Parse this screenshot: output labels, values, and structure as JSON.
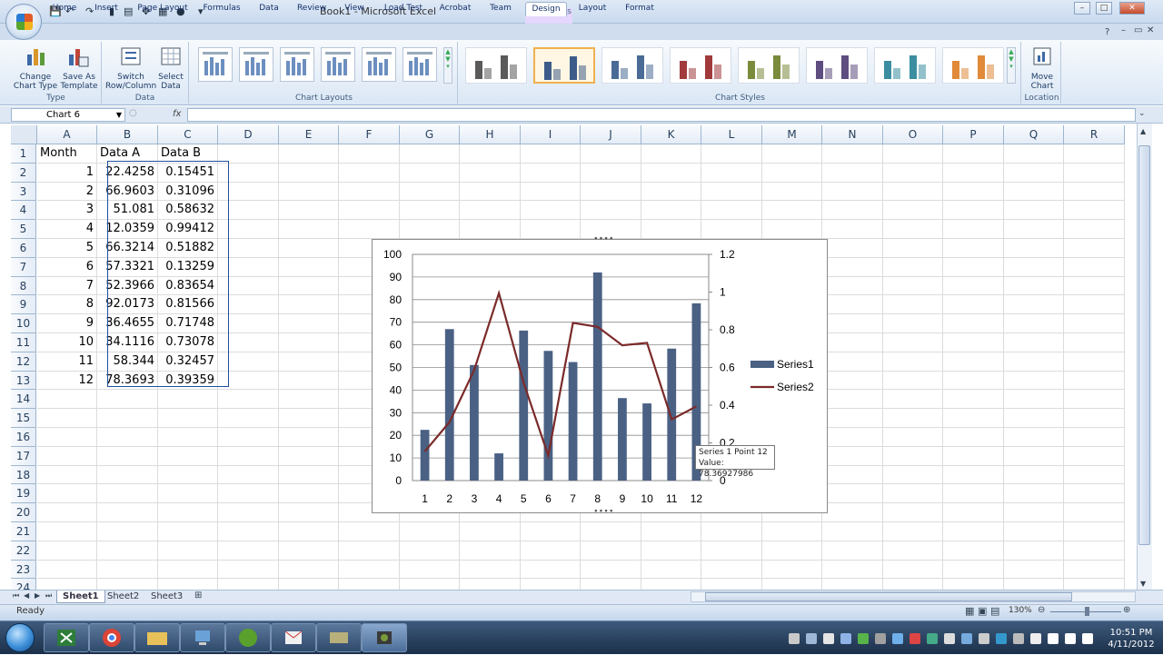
{
  "window": {
    "title": "Book1 - Microsoft Excel",
    "context_tab_group": "Chart Tools",
    "controls": {
      "minimize": "–",
      "maximize": "□",
      "close": "✕"
    }
  },
  "ribbon_tabs": [
    "Home",
    "Insert",
    "Page Layout",
    "Formulas",
    "Data",
    "Review",
    "View",
    "Load Test",
    "Acrobat",
    "Team",
    "Design",
    "Layout",
    "Format"
  ],
  "active_tab": "Design",
  "ribbon_groups": {
    "type": {
      "label": "Type",
      "buttons": [
        "Change Chart Type",
        "Save As Template"
      ]
    },
    "data": {
      "label": "Data",
      "buttons": [
        "Switch Row/Column",
        "Select Data"
      ]
    },
    "chart_layouts": {
      "label": "Chart Layouts"
    },
    "chart_styles": {
      "label": "Chart Styles"
    },
    "location": {
      "label": "Location",
      "buttons": [
        "Move Chart"
      ]
    }
  },
  "style_colors": [
    "#5a5a5a",
    "#3e5c8a",
    "#4a6b96",
    "#a13b3b",
    "#7a8b3c",
    "#5e4d80",
    "#3b8ea0",
    "#e08a3a"
  ],
  "formula_bar": {
    "name_box": "Chart 6",
    "fx": "fx",
    "formula": ""
  },
  "columns": [
    "A",
    "B",
    "C",
    "D",
    "E",
    "F",
    "G",
    "H",
    "I",
    "J",
    "K",
    "L",
    "M",
    "N",
    "O",
    "P",
    "Q",
    "R"
  ],
  "rows": [
    "1",
    "2",
    "3",
    "4",
    "5",
    "6",
    "7",
    "8",
    "9",
    "10",
    "11",
    "12",
    "13",
    "14",
    "15",
    "16",
    "17",
    "18",
    "19",
    "20",
    "21",
    "22",
    "23",
    "24"
  ],
  "table": {
    "headers": [
      "Month",
      "Data A",
      "Data B"
    ],
    "data": [
      [
        "1",
        "22.4258",
        "0.15451"
      ],
      [
        "2",
        "66.9603",
        "0.31096"
      ],
      [
        "3",
        "51.081",
        "0.58632"
      ],
      [
        "4",
        "12.0359",
        "0.99412"
      ],
      [
        "5",
        "66.3214",
        "0.51882"
      ],
      [
        "6",
        "57.3321",
        "0.13259"
      ],
      [
        "7",
        "52.3966",
        "0.83654"
      ],
      [
        "8",
        "92.0173",
        "0.81566"
      ],
      [
        "9",
        "36.4655",
        "0.71748"
      ],
      [
        "10",
        "34.1116",
        "0.73078"
      ],
      [
        "11",
        "58.344",
        "0.32457"
      ],
      [
        "12",
        "78.3693",
        "0.39359"
      ]
    ]
  },
  "chart_data": {
    "type": "bar",
    "categories": [
      "1",
      "2",
      "3",
      "4",
      "5",
      "6",
      "7",
      "8",
      "9",
      "10",
      "11",
      "12"
    ],
    "series": [
      {
        "name": "Series1",
        "chart": "bar",
        "axis": "primary",
        "color": "#4a6184",
        "values": [
          22.4258,
          66.9603,
          51.081,
          12.0359,
          66.3214,
          57.3321,
          52.3966,
          92.0173,
          36.4655,
          34.1116,
          58.344,
          78.3693
        ]
      },
      {
        "name": "Series2",
        "chart": "line",
        "axis": "secondary",
        "color": "#7b2a2a",
        "values": [
          0.15451,
          0.31096,
          0.58632,
          0.99412,
          0.51882,
          0.13259,
          0.83654,
          0.81566,
          0.71748,
          0.73078,
          0.32457,
          0.39359
        ]
      }
    ],
    "ylim": [
      0,
      100
    ],
    "yticks": [
      "0",
      "10",
      "20",
      "30",
      "40",
      "50",
      "60",
      "70",
      "80",
      "90",
      "100"
    ],
    "y2lim": [
      0,
      1.2
    ],
    "y2ticks": [
      "0",
      "0.2",
      "0.4",
      "0.6",
      "0.8",
      "1",
      "1.2"
    ],
    "grid": true,
    "legend": "right"
  },
  "tooltip": {
    "line1": "Series 1 Point 12",
    "line2": "Value: 78.36927986"
  },
  "sheet_tabs": [
    "Sheet1",
    "Sheet2",
    "Sheet3"
  ],
  "active_sheet": "Sheet1",
  "status": {
    "ready": "Ready",
    "zoom": "130%"
  },
  "taskbar": {
    "time": "10:51 PM",
    "date": "4/11/2012"
  }
}
